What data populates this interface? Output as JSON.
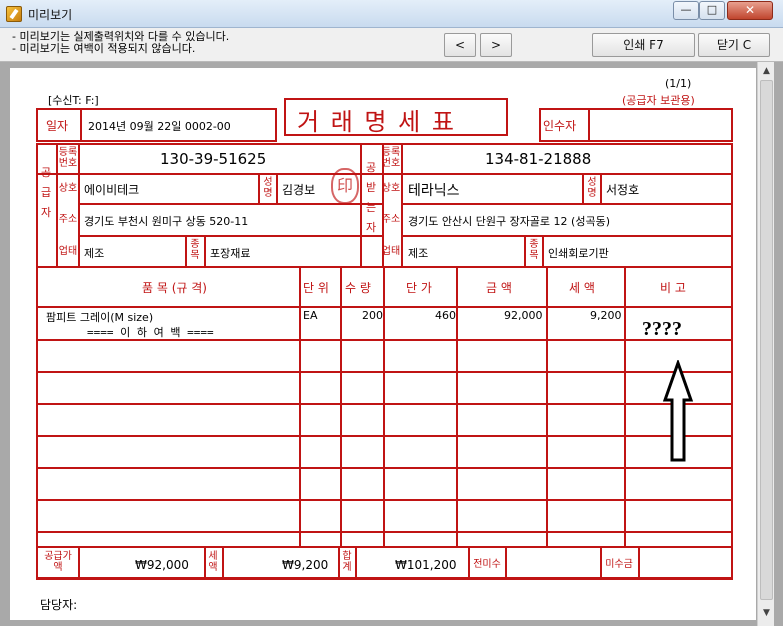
{
  "window": {
    "title": "미리보기",
    "minimize_glyph": "—",
    "maximize_glyph": "□",
    "close_glyph": "✕"
  },
  "toolbar": {
    "notice_line1": "- 미리보기는 실제출력위치와 다를 수 있습니다.",
    "notice_line2": "- 미리보기는 여백이 적용되지 않습니다.",
    "prev_label": "<",
    "next_label": ">",
    "print_label": "인쇄 F7",
    "close_label": "닫기 C"
  },
  "document": {
    "receiver_label": "[수신T: F:]",
    "page_label": "(1/1)",
    "copy_label": "(공급자 보관용)",
    "title": "거 래 명 세 표",
    "date_label": "일자",
    "date_value": "2014년 09월 22일  0002-00",
    "signer_label": "인수자",
    "stamp_text": "印",
    "supplier": {
      "side_label": [
        "공",
        "급",
        "자"
      ],
      "reg_label": "등록번호",
      "reg_no": "130-39-51625",
      "company_label": "상호",
      "company": "에이비테크",
      "name_label": "성명",
      "name": "김경보",
      "address_label": "주소",
      "address": "경기도 부천시 원미구 상동 520-11",
      "biz_label": "업태",
      "biz": "제조",
      "item_label": "종목",
      "item": "포장재료"
    },
    "receiver": {
      "side_label": [
        "공",
        "받",
        "는",
        "자"
      ],
      "reg_label": "등록번호",
      "reg_no": "134-81-21888",
      "company_label": "상호",
      "company": "테라닉스",
      "name_label": "성명",
      "name": "서정호",
      "address_label": "주소",
      "address": "경기도 안산시 단원구 장자골로 12 (성곡동)",
      "biz_label": "업태",
      "biz": "제조",
      "item_label": "종목",
      "item": "인쇄회로기판"
    },
    "table_headers": {
      "item": "품  목  (규  격)",
      "unit": "단 위",
      "qty": "수 량",
      "price": "단 가",
      "amount": "금  액",
      "tax": "세  액",
      "note": "비  고"
    },
    "rows": [
      {
        "item": "팜피트 그레이(M size)",
        "unit": "EA",
        "qty": "200",
        "price": "460",
        "amount": "92,000",
        "tax": "9,200",
        "note": "????"
      }
    ],
    "end_marker": "==== 이 하 여 백 ====",
    "totals": {
      "supply_label": "공급가액",
      "supply": "₩92,000",
      "tax_label": "세액",
      "tax": "₩9,200",
      "sum_label": "합계",
      "sum": "₩101,200",
      "prev_unpaid_label": "전미수",
      "unpaid_label": "미수금"
    },
    "manager_label": "담당자:"
  },
  "colors": {
    "form_red": "#c01414",
    "titlebar_top": "#e4eef9",
    "preview_bg": "#a9a9a9"
  }
}
